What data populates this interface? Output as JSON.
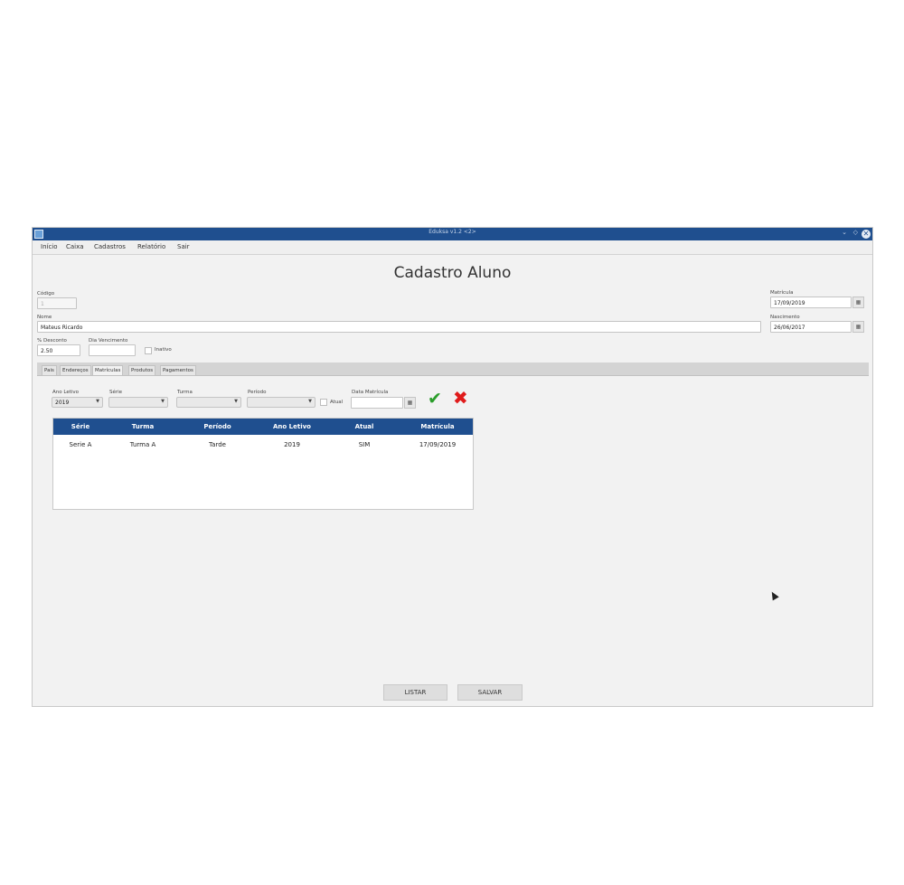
{
  "window": {
    "title": "Eduksa v1.2 <2>",
    "controls": {
      "minimize": "⌄",
      "restore": "◇",
      "close": "✕"
    }
  },
  "menu": [
    "Início",
    "Caixa",
    "Cadastros",
    "Relatório",
    "Sair"
  ],
  "page": {
    "title": "Cadastro Aluno"
  },
  "form": {
    "codigo": {
      "label": "Código",
      "value": "1"
    },
    "nome": {
      "label": "Nome",
      "value": "Mateus Ricardo"
    },
    "desconto": {
      "label": "% Desconto",
      "value": "2.50"
    },
    "dia_vencimento": {
      "label": "Dia Vencimento",
      "value": ""
    },
    "inativo": {
      "label": "Inativo",
      "checked": false
    },
    "matricula": {
      "label": "Matrícula",
      "value": "17/09/2019"
    },
    "nascimento": {
      "label": "Nascimento",
      "value": "26/06/2017"
    }
  },
  "tabs": [
    "Pais",
    "Endereços",
    "Matrículas",
    "Produtos",
    "Pagamentos"
  ],
  "matriculas_form": {
    "ano_letivo": {
      "label": "Ano Letivo",
      "value": "2019"
    },
    "serie": {
      "label": "Série",
      "value": ""
    },
    "turma": {
      "label": "Turma",
      "value": ""
    },
    "periodo": {
      "label": "Período",
      "value": ""
    },
    "atual": {
      "label": "Atual",
      "checked": false
    },
    "data_matricula": {
      "label": "Data Matrícula",
      "value": ""
    }
  },
  "table": {
    "columns": [
      "Série",
      "Turma",
      "Período",
      "Ano Letivo",
      "Atual",
      "Matrícula"
    ],
    "rows": [
      [
        "Serie A",
        "Turma A",
        "Tarde",
        "2019",
        "SIM",
        "17/09/2019"
      ]
    ]
  },
  "buttons": {
    "listar": "LISTAR",
    "salvar": "SALVAR"
  },
  "icons": {
    "app": "app-icon",
    "calendar": "calendar-icon",
    "confirm": "checkmark-icon",
    "cancel": "x-icon",
    "cursor": "mouse-pointer-icon"
  },
  "colors": {
    "accent": "#1f4f8f",
    "confirm": "#2a9d2a",
    "cancel": "#e01b1b"
  }
}
